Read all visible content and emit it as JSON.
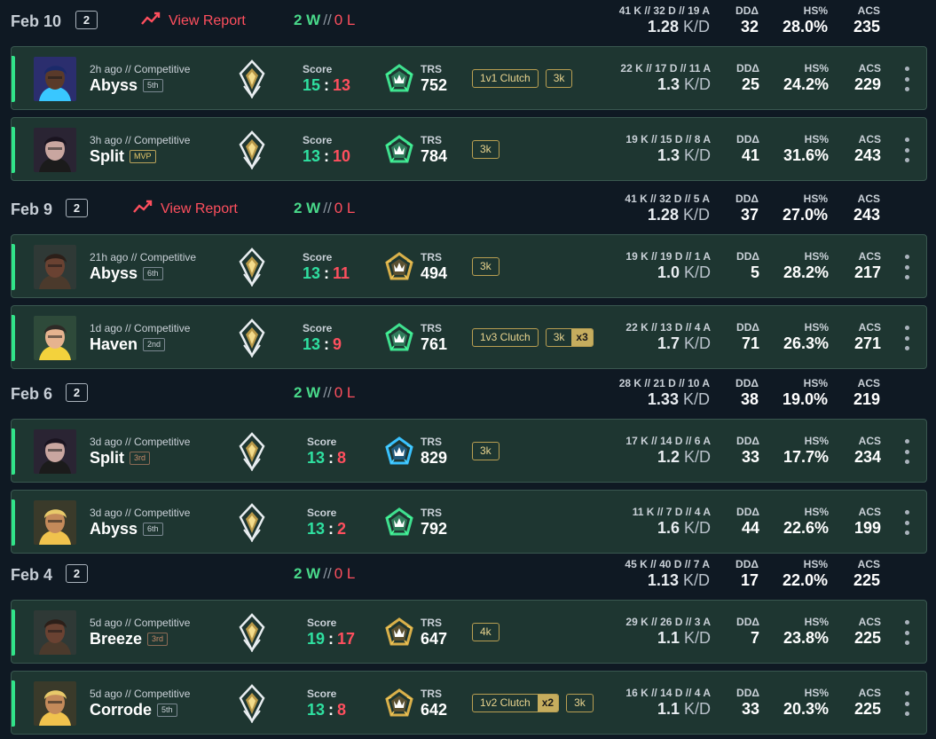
{
  "colors": {
    "background": "#0f1923",
    "card": "#1e3631",
    "win_accent": "#31e389",
    "loss_red": "#ff4f5e",
    "score_win": "#2fe0a0",
    "badge_gold": "#c6ad5e"
  },
  "labels": {
    "view_report": "View Report",
    "score": "Score",
    "trs": "TRS",
    "dd": "DDΔ",
    "hs": "HS%",
    "acs": "ACS",
    "kd_unit": "K/D",
    "wl_sep": "//"
  },
  "groups": [
    {
      "date": "Feb 10",
      "count": "2",
      "wins": "2 W",
      "losses": "0 L",
      "has_report": true,
      "summary": {
        "kda": "41 K // 32 D // 19 A",
        "kd": "1.28",
        "dd": "32",
        "hs": "28.0%",
        "acs": "235"
      },
      "matches": [
        {
          "agent_icon": "agent-neon-icon",
          "meta": "2h ago // Competitive",
          "map": "Abyss",
          "place": "5th",
          "place_style": "normal",
          "score_a": "15",
          "score_b": "13",
          "trs_tier": "emerald",
          "trs": "752",
          "badges": [
            {
              "text": "1v1 Clutch"
            },
            {
              "text": "3k"
            }
          ],
          "kda": "22 K // 17 D // 11 A",
          "kd": "1.3",
          "dd": "25",
          "hs": "24.2%",
          "acs": "229"
        },
        {
          "agent_icon": "agent-reyna-icon",
          "meta": "3h ago // Competitive",
          "map": "Split",
          "place": "MVP",
          "place_style": "mvp",
          "score_a": "13",
          "score_b": "10",
          "trs_tier": "emerald",
          "trs": "784",
          "badges": [
            {
              "text": "3k"
            }
          ],
          "kda": "19 K // 15 D // 8 A",
          "kd": "1.3",
          "dd": "41",
          "hs": "31.6%",
          "acs": "243"
        }
      ]
    },
    {
      "date": "Feb 9",
      "count": "2",
      "wins": "2 W",
      "losses": "0 L",
      "has_report": true,
      "summary": {
        "kda": "41 K // 32 D // 5 A",
        "kd": "1.28",
        "dd": "37",
        "hs": "27.0%",
        "acs": "243"
      },
      "matches": [
        {
          "agent_icon": "agent-brimstone-icon",
          "meta": "21h ago // Competitive",
          "map": "Abyss",
          "place": "6th",
          "place_style": "normal",
          "score_a": "13",
          "score_b": "11",
          "trs_tier": "gold",
          "trs": "494",
          "badges": [
            {
              "text": "3k"
            }
          ],
          "kda": "19 K // 19 D // 1 A",
          "kd": "1.0",
          "dd": "5",
          "hs": "28.2%",
          "acs": "217"
        },
        {
          "agent_icon": "agent-killjoy-icon",
          "meta": "1d ago // Competitive",
          "map": "Haven",
          "place": "2nd",
          "place_style": "normal",
          "score_a": "13",
          "score_b": "9",
          "trs_tier": "emerald",
          "trs": "761",
          "badges": [
            {
              "text": "1v3 Clutch"
            },
            {
              "text": "3k",
              "mult": "x3"
            }
          ],
          "kda": "22 K // 13 D // 4 A",
          "kd": "1.7",
          "dd": "71",
          "hs": "26.3%",
          "acs": "271"
        }
      ]
    },
    {
      "date": "Feb 6",
      "count": "2",
      "wins": "2 W",
      "losses": "0 L",
      "has_report": false,
      "summary": {
        "kda": "28 K // 21 D // 10 A",
        "kd": "1.33",
        "dd": "38",
        "hs": "19.0%",
        "acs": "219"
      },
      "matches": [
        {
          "agent_icon": "agent-reyna-icon",
          "meta": "3d ago // Competitive",
          "map": "Split",
          "place": "3rd",
          "place_style": "bronze",
          "score_a": "13",
          "score_b": "8",
          "trs_tier": "diamond",
          "trs": "829",
          "badges": [
            {
              "text": "3k"
            }
          ],
          "kda": "17 K // 14 D // 6 A",
          "kd": "1.2",
          "dd": "33",
          "hs": "17.7%",
          "acs": "234"
        },
        {
          "agent_icon": "agent-phoenix-icon",
          "meta": "3d ago // Competitive",
          "map": "Abyss",
          "place": "6th",
          "place_style": "normal",
          "score_a": "13",
          "score_b": "2",
          "trs_tier": "emerald",
          "trs": "792",
          "badges": [],
          "kda": "11 K // 7 D // 4 A",
          "kd": "1.6",
          "dd": "44",
          "hs": "22.6%",
          "acs": "199"
        }
      ]
    },
    {
      "date": "Feb 4",
      "count": "2",
      "wins": "2 W",
      "losses": "0 L",
      "has_report": false,
      "summary": {
        "kda": "45 K // 40 D // 7 A",
        "kd": "1.13",
        "dd": "17",
        "hs": "22.0%",
        "acs": "225"
      },
      "matches": [
        {
          "agent_icon": "agent-brimstone-icon",
          "meta": "5d ago // Competitive",
          "map": "Breeze",
          "place": "3rd",
          "place_style": "bronze",
          "score_a": "19",
          "score_b": "17",
          "trs_tier": "gold",
          "trs": "647",
          "badges": [
            {
              "text": "4k"
            }
          ],
          "kda": "29 K // 26 D // 3 A",
          "kd": "1.1",
          "dd": "7",
          "hs": "23.8%",
          "acs": "225"
        },
        {
          "agent_icon": "agent-phoenix-icon",
          "meta": "5d ago // Competitive",
          "map": "Corrode",
          "place": "5th",
          "place_style": "normal",
          "score_a": "13",
          "score_b": "8",
          "trs_tier": "gold",
          "trs": "642",
          "badges": [
            {
              "text": "1v2 Clutch",
              "mult": "x2"
            },
            {
              "text": "3k"
            }
          ],
          "kda": "16 K // 14 D // 4 A",
          "kd": "1.1",
          "dd": "33",
          "hs": "20.3%",
          "acs": "225"
        }
      ]
    }
  ]
}
